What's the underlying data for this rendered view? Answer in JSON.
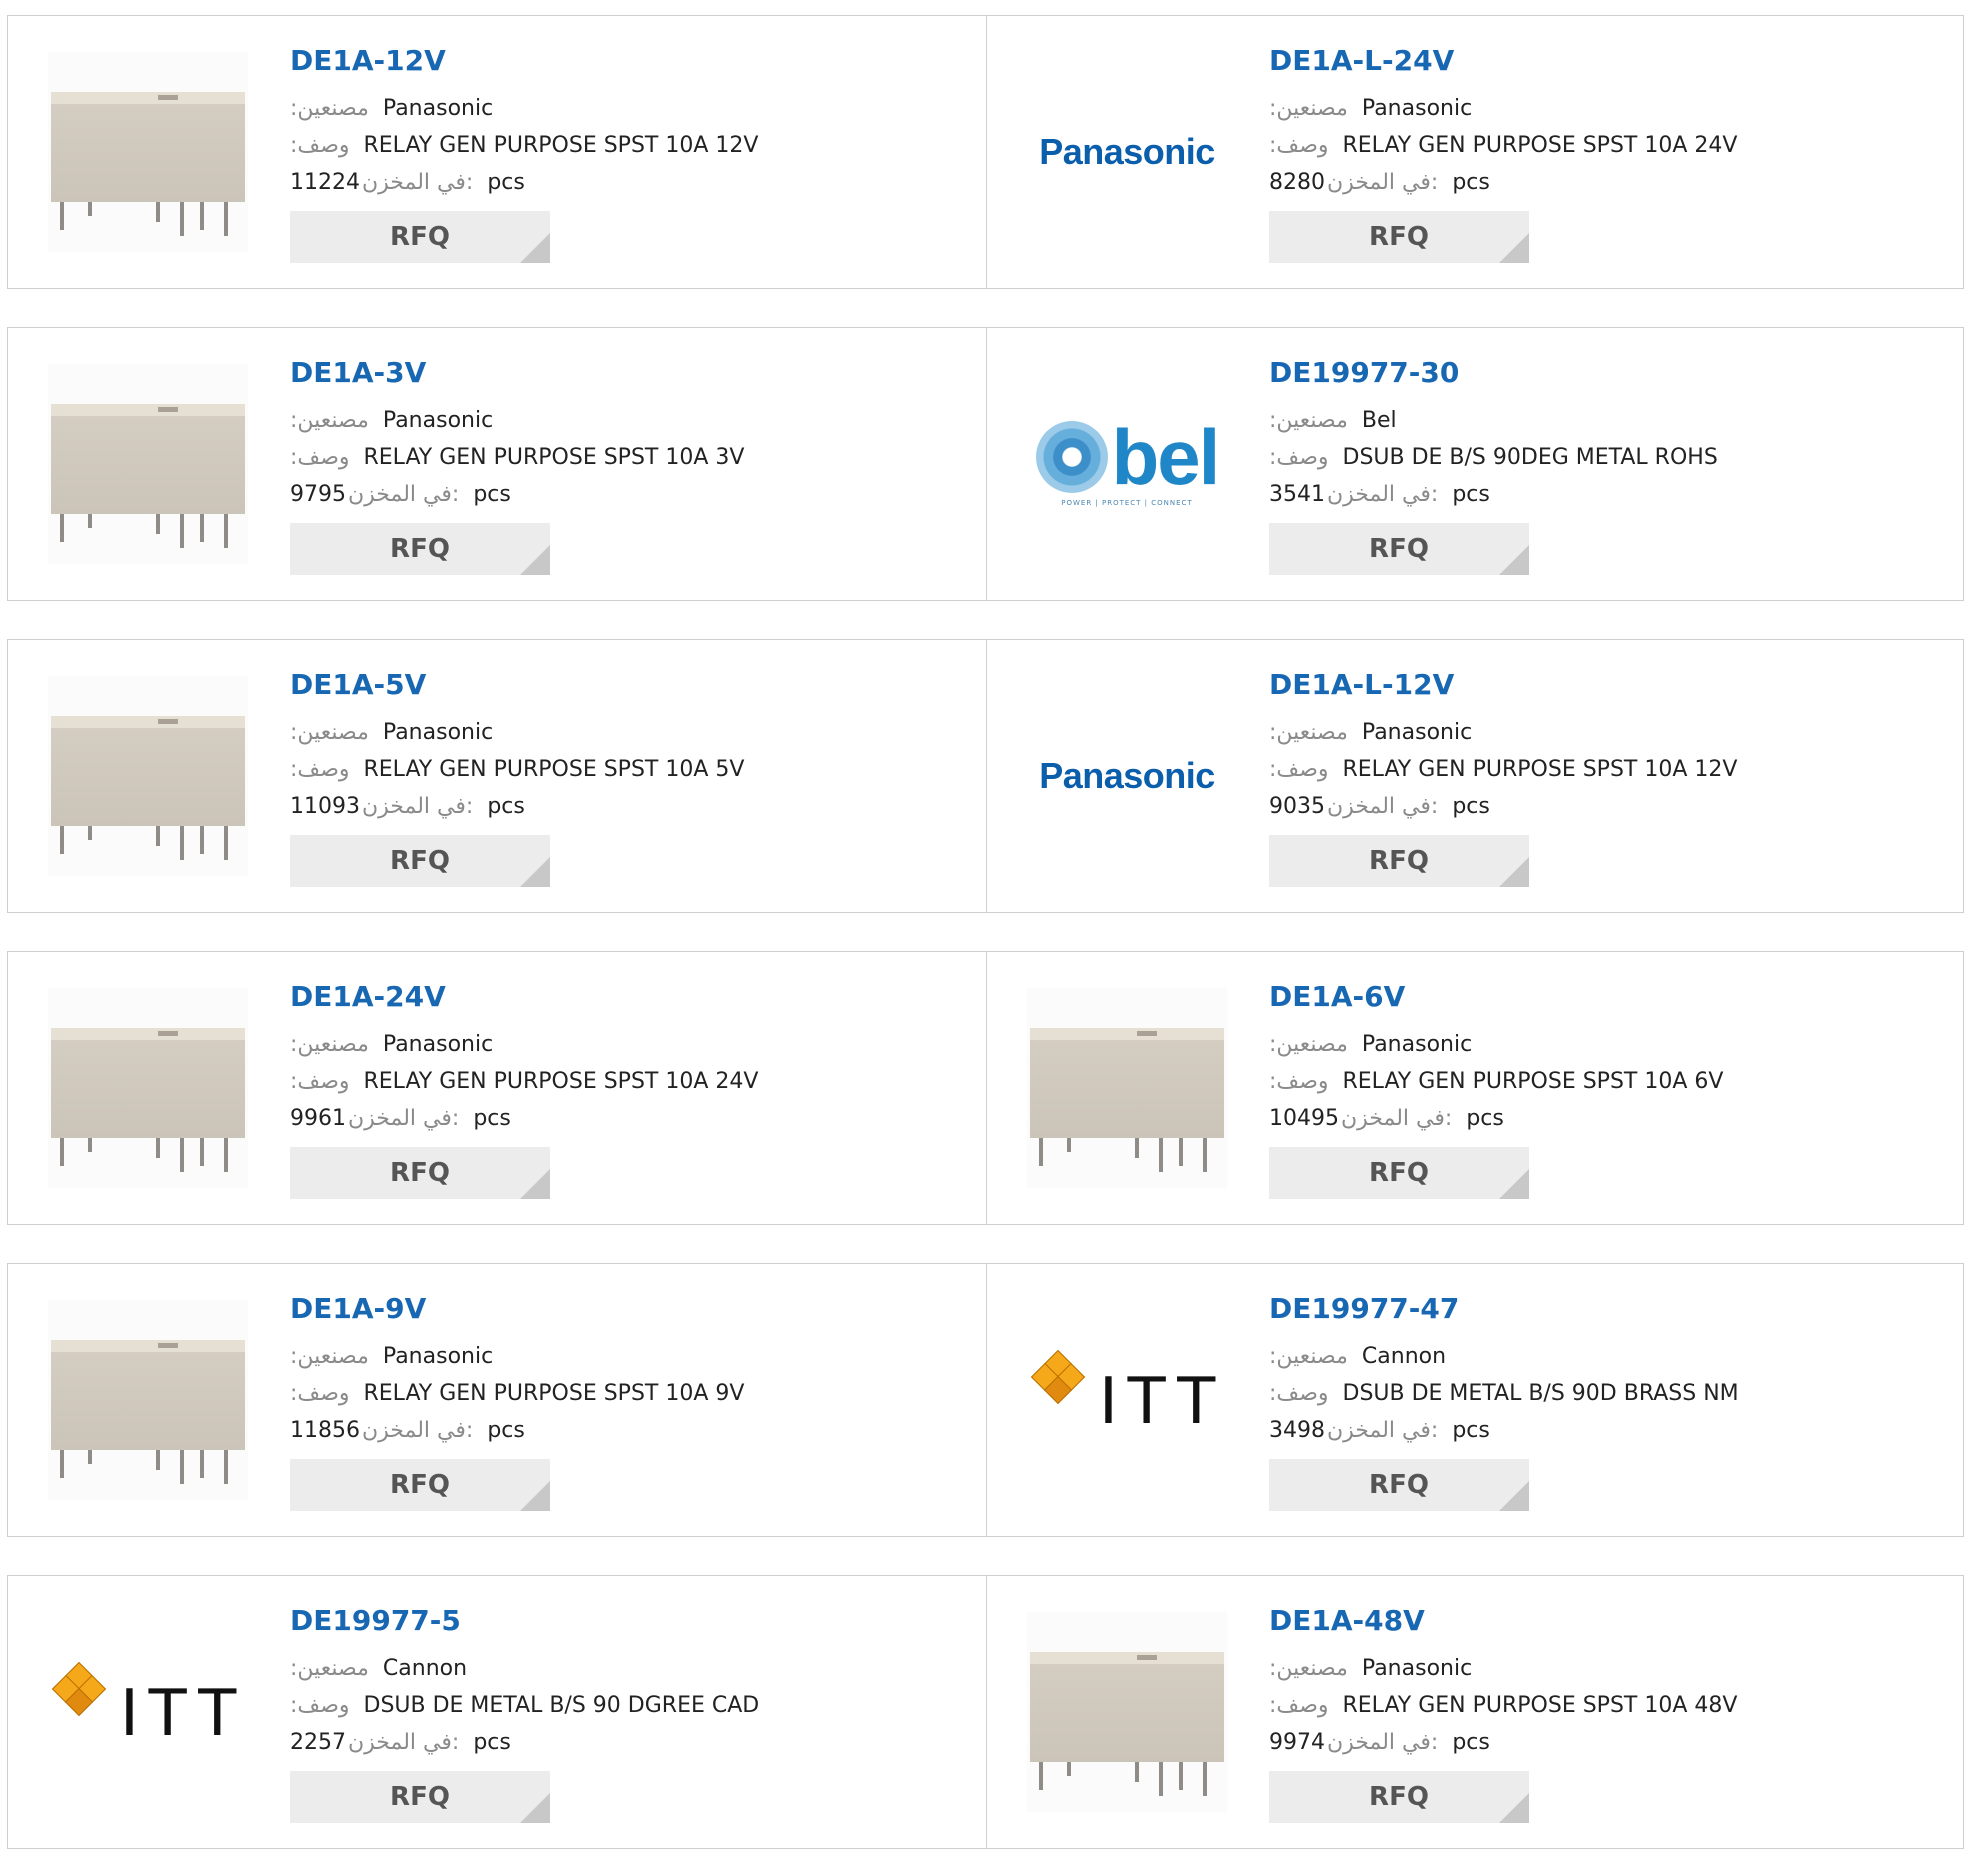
{
  "labels": {
    "manufacturer": ":مصنعين",
    "description": ":وصف",
    "stock": "في المخزن:",
    "unit": "pcs",
    "rfq": "RFQ"
  },
  "colors": {
    "link": "#1767b3",
    "panasonic": "#0a5eab",
    "bel": "#1f86c8",
    "itt_orange": "#f5a81a"
  },
  "products": [
    {
      "part": "DE1A-12V",
      "manufacturer": "Panasonic",
      "description": "RELAY GEN PURPOSE SPST 10A 12V",
      "stock": "11224",
      "image": "relay"
    },
    {
      "part": "DE1A-L-24V",
      "manufacturer": "Panasonic",
      "description": "RELAY GEN PURPOSE SPST 10A 24V",
      "stock": "8280",
      "image": "panasonic-logo",
      "logo_text": "Panasonic"
    },
    {
      "part": "DE1A-3V",
      "manufacturer": "Panasonic",
      "description": "RELAY GEN PURPOSE SPST 10A 3V",
      "stock": "9795",
      "image": "relay"
    },
    {
      "part": "DE19977-30",
      "manufacturer": "Bel",
      "description": "DSUB DE B/S 90DEG METAL ROHS",
      "stock": "3541",
      "image": "bel-logo",
      "logo_text": "bel",
      "logo_tagline": "POWER | PROTECT | CONNECT"
    },
    {
      "part": "DE1A-5V",
      "manufacturer": "Panasonic",
      "description": "RELAY GEN PURPOSE SPST 10A 5V",
      "stock": "11093",
      "image": "relay"
    },
    {
      "part": "DE1A-L-12V",
      "manufacturer": "Panasonic",
      "description": "RELAY GEN PURPOSE SPST 10A 12V",
      "stock": "9035",
      "image": "panasonic-logo",
      "logo_text": "Panasonic"
    },
    {
      "part": "DE1A-24V",
      "manufacturer": "Panasonic",
      "description": "RELAY GEN PURPOSE SPST 10A 24V",
      "stock": "9961",
      "image": "relay"
    },
    {
      "part": "DE1A-6V",
      "manufacturer": "Panasonic",
      "description": "RELAY GEN PURPOSE SPST 10A 6V",
      "stock": "10495",
      "image": "relay"
    },
    {
      "part": "DE1A-9V",
      "manufacturer": "Panasonic",
      "description": "RELAY GEN PURPOSE SPST 10A 9V",
      "stock": "11856",
      "image": "relay"
    },
    {
      "part": "DE19977-47",
      "manufacturer": "Cannon",
      "description": "DSUB DE METAL B/S 90D BRASS NM",
      "stock": "3498",
      "image": "itt-logo",
      "logo_text": "ITT"
    },
    {
      "part": "DE19977-5",
      "manufacturer": "Cannon",
      "description": "DSUB DE METAL B/S 90 DGREE CAD",
      "stock": "2257",
      "image": "itt-logo",
      "logo_text": "ITT"
    },
    {
      "part": "DE1A-48V",
      "manufacturer": "Panasonic",
      "description": "RELAY GEN PURPOSE SPST 10A 48V",
      "stock": "9974",
      "image": "relay"
    }
  ]
}
